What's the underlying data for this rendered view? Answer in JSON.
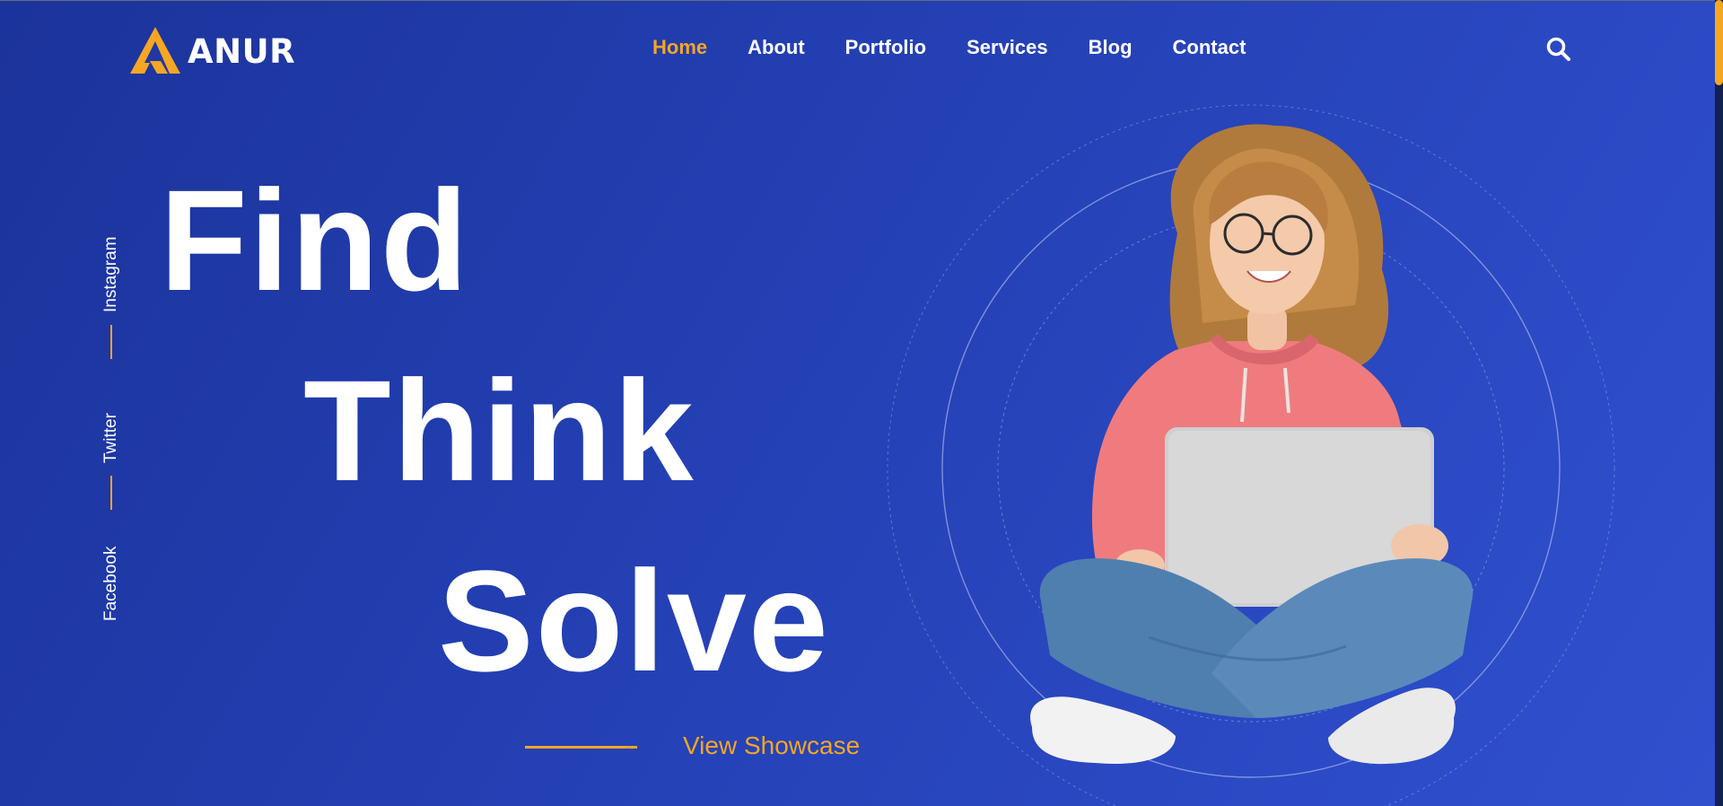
{
  "brand": {
    "name": "ANUR",
    "accent": "#f5a623"
  },
  "nav": [
    {
      "label": "Home",
      "active": true
    },
    {
      "label": "About",
      "active": false
    },
    {
      "label": "Portfolio",
      "active": false
    },
    {
      "label": "Services",
      "active": false
    },
    {
      "label": "Blog",
      "active": false
    },
    {
      "label": "Contact",
      "active": false
    }
  ],
  "header": {
    "search_icon": "search-icon"
  },
  "social": [
    "Instagram",
    "Twitter",
    "Facebook"
  ],
  "hero": {
    "line1": "Find",
    "line2": "Think",
    "line3": "Solve",
    "cta": "View Showcase"
  }
}
